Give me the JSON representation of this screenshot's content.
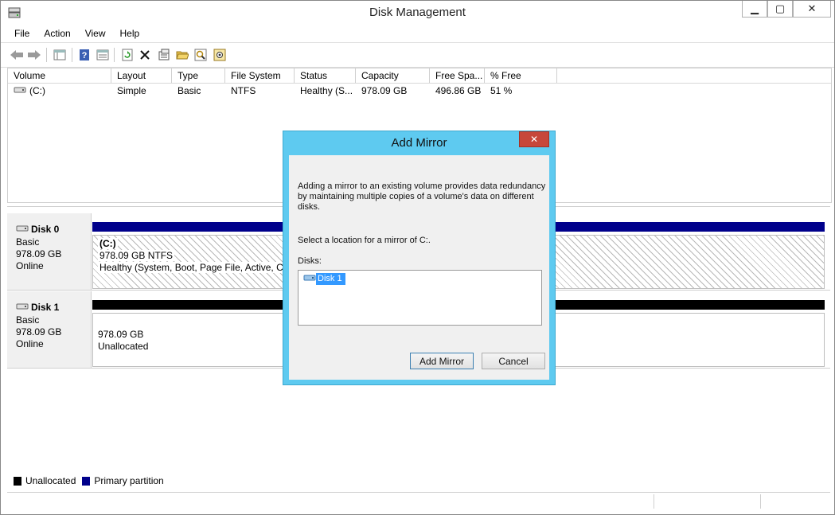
{
  "window": {
    "title": "Disk Management"
  },
  "menu": [
    "File",
    "Action",
    "View",
    "Help"
  ],
  "toolbar": {
    "icons": [
      "back-arrow-icon",
      "forward-arrow-icon",
      "console-tree-icon",
      "help-icon",
      "properties-view-icon",
      "refresh-icon",
      "delete-icon",
      "properties-icon",
      "open-icon",
      "search-icon",
      "settings-icon"
    ]
  },
  "volume_table": {
    "columns": [
      "Volume",
      "Layout",
      "Type",
      "File System",
      "Status",
      "Capacity",
      "Free Spa...",
      "% Free"
    ],
    "rows": [
      {
        "volume": "(C:)",
        "layout": "Simple",
        "type": "Basic",
        "fs": "NTFS",
        "status": "Healthy (S...",
        "capacity": "978.09 GB",
        "free": "496.86 GB",
        "pct": "51 %"
      }
    ]
  },
  "disks": [
    {
      "name": "Disk 0",
      "type": "Basic",
      "size": "978.09 GB",
      "state": "Online",
      "partition": {
        "label": "(C:)",
        "size_fs": "978.09 GB NTFS",
        "status": "Healthy (System, Boot, Page File, Active, Cra",
        "kind": "primary"
      }
    },
    {
      "name": "Disk 1",
      "type": "Basic",
      "size": "978.09 GB",
      "state": "Online",
      "partition": {
        "size": "978.09 GB",
        "status": "Unallocated",
        "kind": "unallocated"
      }
    }
  ],
  "legend": {
    "unallocated": "Unallocated",
    "primary": "Primary partition"
  },
  "colors": {
    "primary": "#00008b",
    "unallocated": "#000000",
    "dialog_frame": "#5ecaf0",
    "close_red": "#c7473a",
    "selection": "#3399ff"
  },
  "dialog": {
    "title": "Add Mirror",
    "close": "✕",
    "desc_line1": "Adding a mirror to an existing volume provides data redundancy",
    "desc_line2": "by maintaining multiple copies of a volume's data on different",
    "desc_line3": "disks.",
    "prompt": "Select a location for a mirror of C:.",
    "disks_label": "Disks:",
    "disk_options": [
      "Disk 1"
    ],
    "add_button": "Add Mirror",
    "cancel_button": "Cancel"
  }
}
